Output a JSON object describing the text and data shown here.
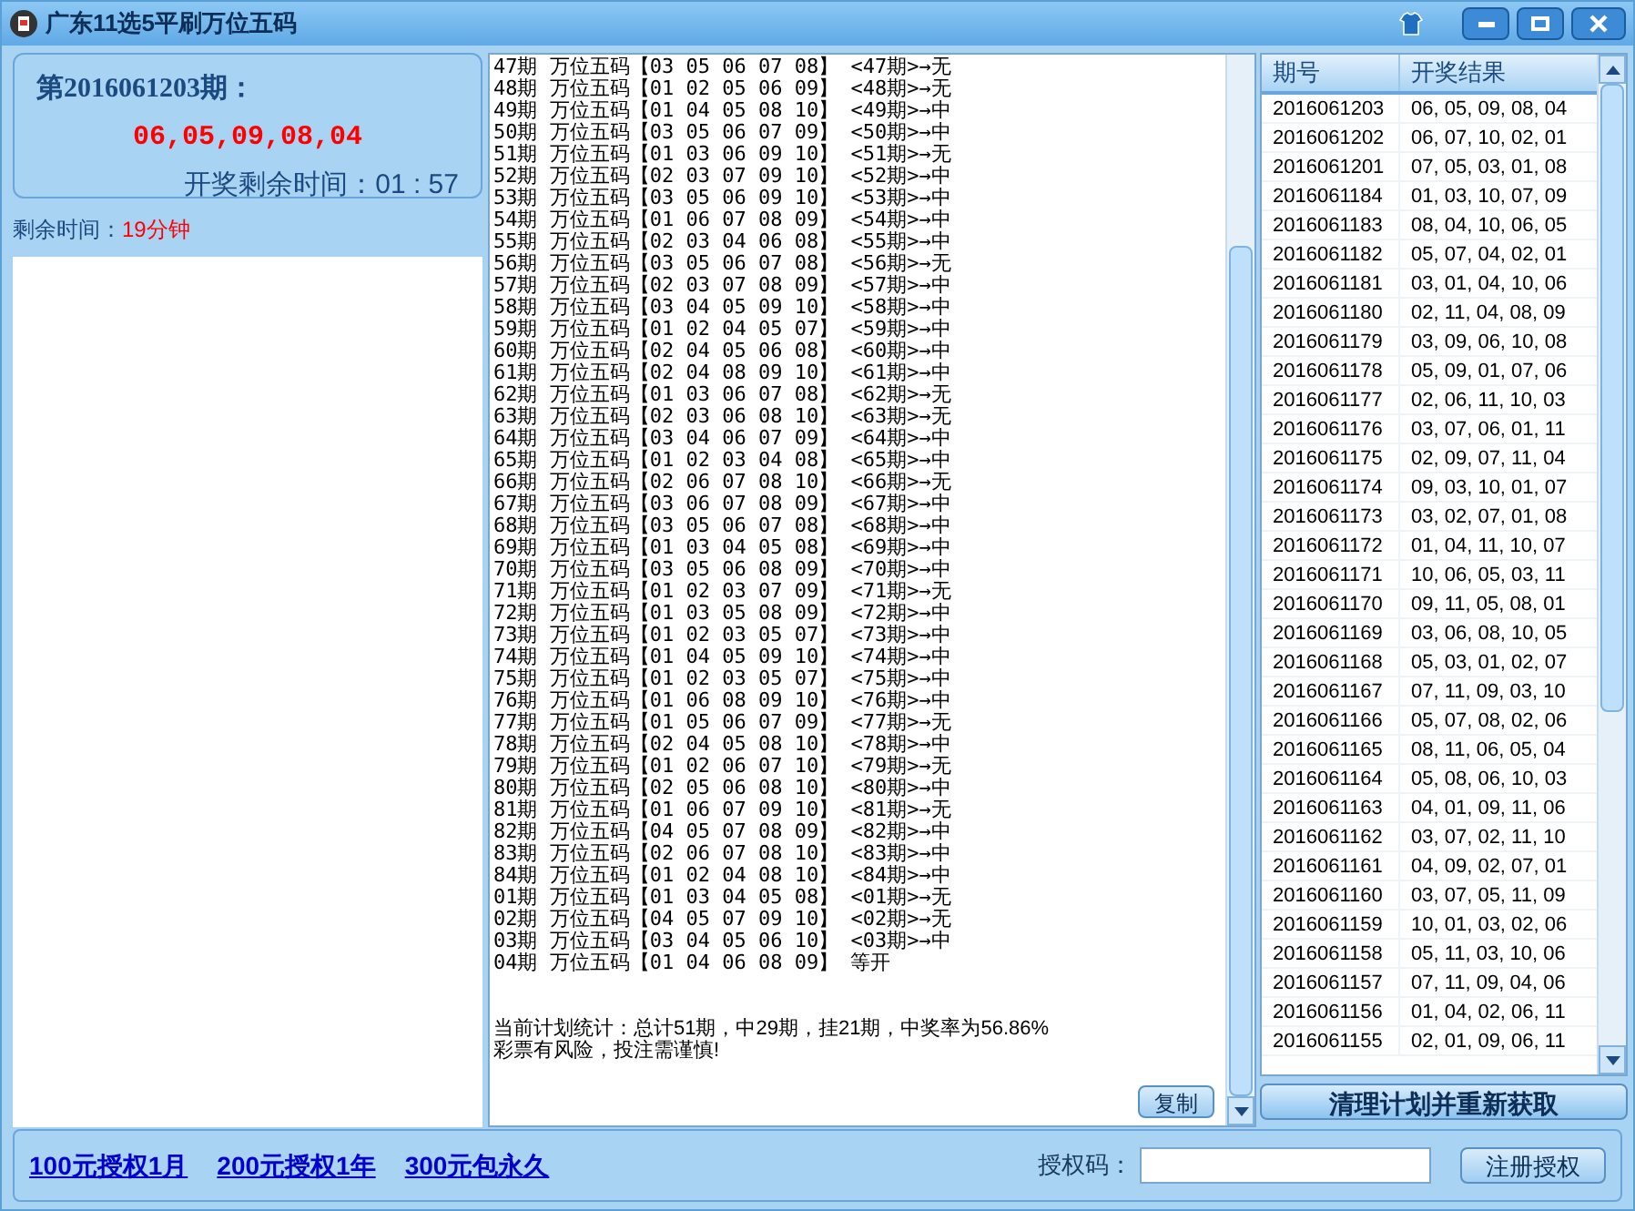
{
  "window": {
    "title": "广东11选5平刷万位五码"
  },
  "current": {
    "issue_label": "第2016061203期：",
    "numbers": "06,05,09,08,04",
    "countdown_label": "开奖剩余时间：",
    "countdown": "01 : 57"
  },
  "remaining": {
    "label": "剩余时间：",
    "value": "19分钟"
  },
  "plan_lines": [
    "47期 万位五码【03 05 06 07 08】 <47期>→无",
    "48期 万位五码【01 02 05 06 09】 <48期>→无",
    "49期 万位五码【01 04 05 08 10】 <49期>→中",
    "50期 万位五码【03 05 06 07 09】 <50期>→中",
    "51期 万位五码【01 03 06 09 10】 <51期>→无",
    "52期 万位五码【02 03 07 09 10】 <52期>→中",
    "53期 万位五码【03 05 06 09 10】 <53期>→中",
    "54期 万位五码【01 06 07 08 09】 <54期>→中",
    "55期 万位五码【02 03 04 06 08】 <55期>→中",
    "56期 万位五码【03 05 06 07 08】 <56期>→无",
    "57期 万位五码【02 03 07 08 09】 <57期>→中",
    "58期 万位五码【03 04 05 09 10】 <58期>→中",
    "59期 万位五码【01 02 04 05 07】 <59期>→中",
    "60期 万位五码【02 04 05 06 08】 <60期>→中",
    "61期 万位五码【02 04 08 09 10】 <61期>→中",
    "62期 万位五码【01 03 06 07 08】 <62期>→无",
    "63期 万位五码【02 03 06 08 10】 <63期>→无",
    "64期 万位五码【03 04 06 07 09】 <64期>→中",
    "65期 万位五码【01 02 03 04 08】 <65期>→中",
    "66期 万位五码【02 06 07 08 10】 <66期>→无",
    "67期 万位五码【03 06 07 08 09】 <67期>→中",
    "68期 万位五码【03 05 06 07 08】 <68期>→中",
    "69期 万位五码【01 03 04 05 08】 <69期>→中",
    "70期 万位五码【03 05 06 08 09】 <70期>→中",
    "71期 万位五码【01 02 03 07 09】 <71期>→无",
    "72期 万位五码【01 03 05 08 09】 <72期>→中",
    "73期 万位五码【01 02 03 05 07】 <73期>→中",
    "74期 万位五码【01 04 05 09 10】 <74期>→中",
    "75期 万位五码【01 02 03 05 07】 <75期>→中",
    "76期 万位五码【01 06 08 09 10】 <76期>→中",
    "77期 万位五码【01 05 06 07 09】 <77期>→无",
    "78期 万位五码【02 04 05 08 10】 <78期>→中",
    "79期 万位五码【01 02 06 07 10】 <79期>→无",
    "80期 万位五码【02 05 06 08 10】 <80期>→中",
    "81期 万位五码【01 06 07 09 10】 <81期>→无",
    "82期 万位五码【04 05 07 08 09】 <82期>→中",
    "83期 万位五码【02 06 07 08 10】 <83期>→中",
    "84期 万位五码【01 02 04 08 10】 <84期>→中",
    "01期 万位五码【01 03 04 05 08】 <01期>→无",
    "02期 万位五码【04 05 07 09 10】 <02期>→无",
    "03期 万位五码【03 04 05 06 10】 <03期>→中",
    "04期 万位五码【01 04 06 08 09】 等开"
  ],
  "stats": [
    "当前计划统计：总计51期，中29期，挂21期，中奖率为56.86%",
    "彩票有风险，投注需谨慎!"
  ],
  "copy_button": "复制",
  "table": {
    "columns": [
      "期号",
      "开奖结果"
    ],
    "rows": [
      [
        "2016061203",
        "06, 05, 09, 08, 04"
      ],
      [
        "2016061202",
        "06, 07, 10, 02, 01"
      ],
      [
        "2016061201",
        "07, 05, 03, 01, 08"
      ],
      [
        "2016061184",
        "01, 03, 10, 07, 09"
      ],
      [
        "2016061183",
        "08, 04, 10, 06, 05"
      ],
      [
        "2016061182",
        "05, 07, 04, 02, 01"
      ],
      [
        "2016061181",
        "03, 01, 04, 10, 06"
      ],
      [
        "2016061180",
        "02, 11, 04, 08, 09"
      ],
      [
        "2016061179",
        "03, 09, 06, 10, 08"
      ],
      [
        "2016061178",
        "05, 09, 01, 07, 06"
      ],
      [
        "2016061177",
        "02, 06, 11, 10, 03"
      ],
      [
        "2016061176",
        "03, 07, 06, 01, 11"
      ],
      [
        "2016061175",
        "02, 09, 07, 11, 04"
      ],
      [
        "2016061174",
        "09, 03, 10, 01, 07"
      ],
      [
        "2016061173",
        "03, 02, 07, 01, 08"
      ],
      [
        "2016061172",
        "01, 04, 11, 10, 07"
      ],
      [
        "2016061171",
        "10, 06, 05, 03, 11"
      ],
      [
        "2016061170",
        "09, 11, 05, 08, 01"
      ],
      [
        "2016061169",
        "03, 06, 08, 10, 05"
      ],
      [
        "2016061168",
        "05, 03, 01, 02, 07"
      ],
      [
        "2016061167",
        "07, 11, 09, 03, 10"
      ],
      [
        "2016061166",
        "05, 07, 08, 02, 06"
      ],
      [
        "2016061165",
        "08, 11, 06, 05, 04"
      ],
      [
        "2016061164",
        "05, 08, 06, 10, 03"
      ],
      [
        "2016061163",
        "04, 01, 09, 11, 06"
      ],
      [
        "2016061162",
        "03, 07, 02, 11, 10"
      ],
      [
        "2016061161",
        "04, 09, 02, 07, 01"
      ],
      [
        "2016061160",
        "03, 07, 05, 11, 09"
      ],
      [
        "2016061159",
        "10, 01, 03, 02, 06"
      ],
      [
        "2016061158",
        "05, 11, 03, 10, 06"
      ],
      [
        "2016061157",
        "07, 11, 09, 04, 06"
      ],
      [
        "2016061156",
        "01, 04, 02, 06, 11"
      ],
      [
        "2016061155",
        "02, 01, 09, 06, 11"
      ]
    ]
  },
  "refresh_button": "清理计划并重新获取",
  "links": [
    "100元授权1月",
    "200元授权1年",
    "300元包永久"
  ],
  "auth": {
    "label": "授权码：",
    "button": "注册授权"
  }
}
